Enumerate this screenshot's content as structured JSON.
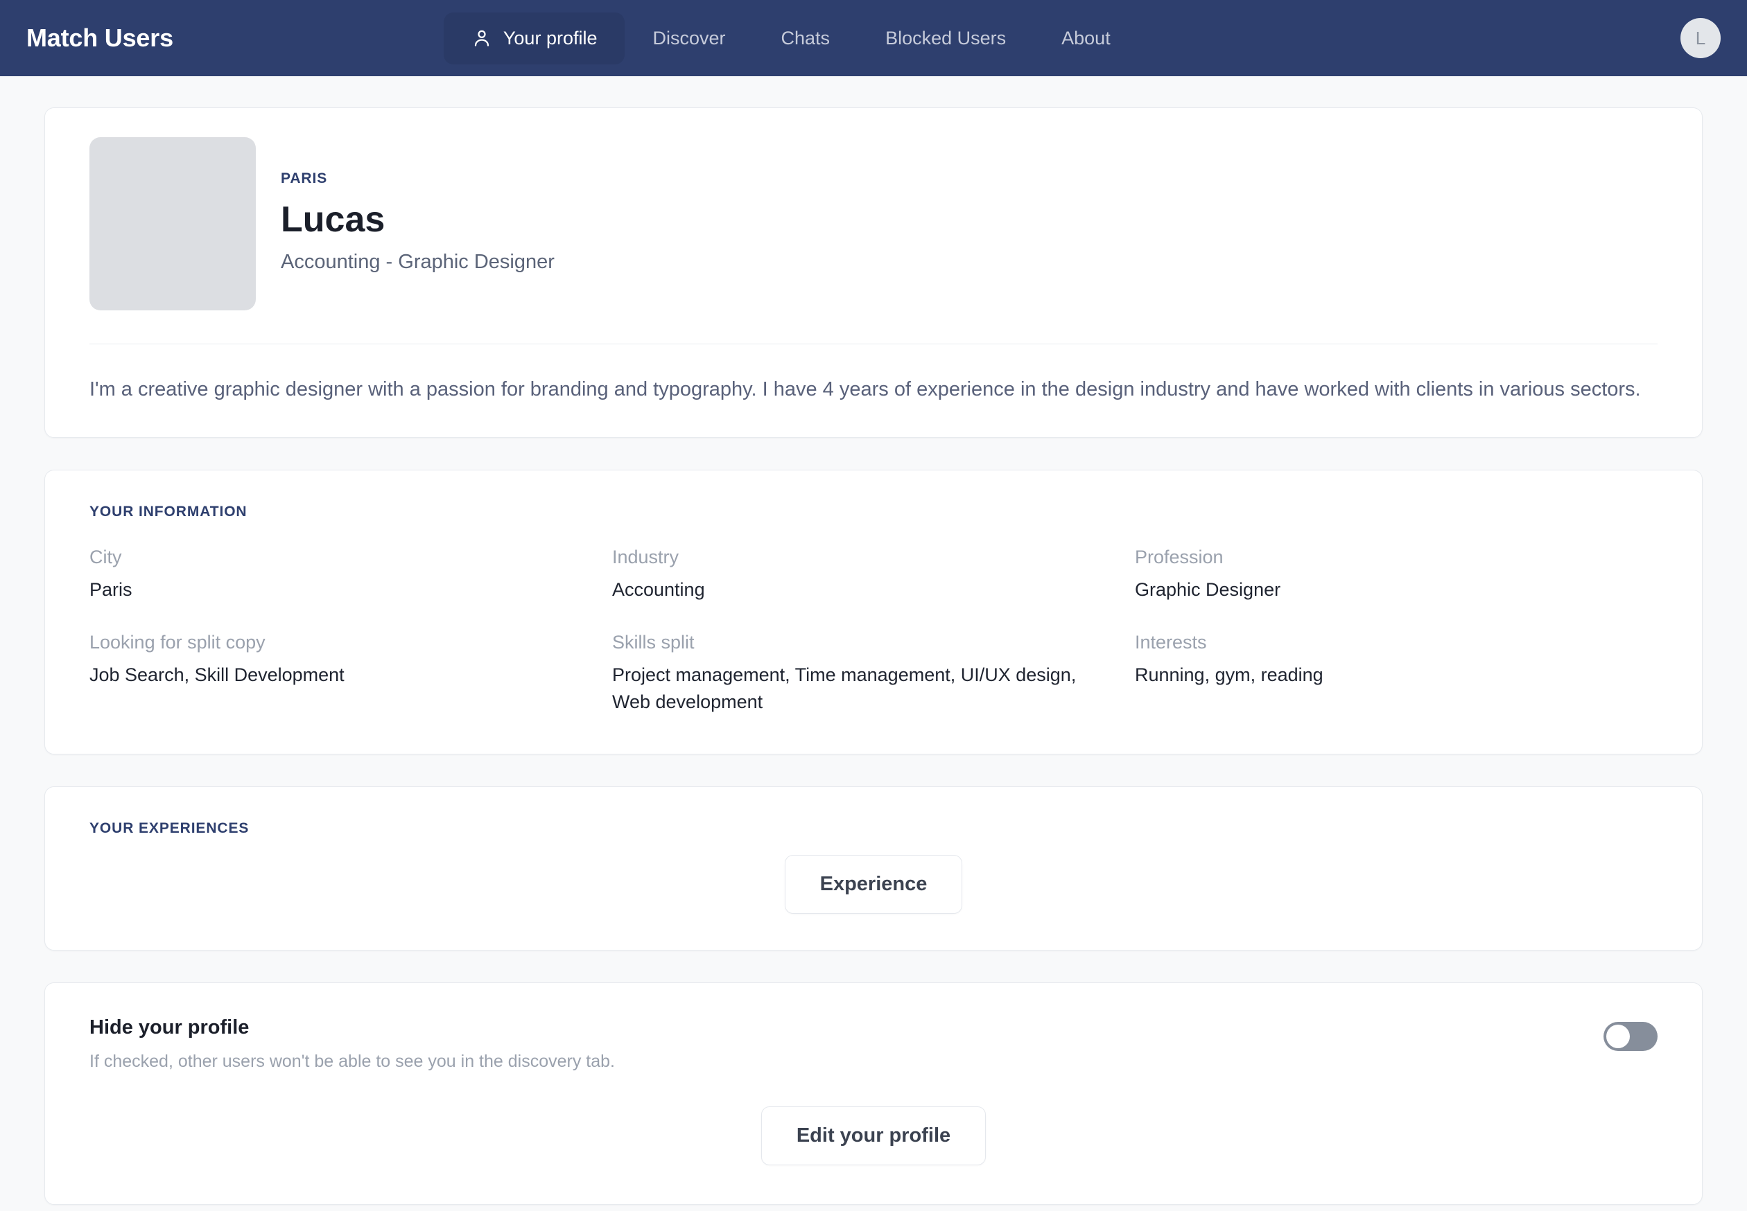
{
  "navbar": {
    "brand": "Match Users",
    "items": [
      {
        "label": "Your profile",
        "icon": "person-icon",
        "active": true
      },
      {
        "label": "Discover",
        "active": false
      },
      {
        "label": "Chats",
        "active": false
      },
      {
        "label": "Blocked Users",
        "active": false
      },
      {
        "label": "About",
        "active": false
      }
    ],
    "avatar_initial": "L",
    "bg_color": "#2e3f6e",
    "active_pill_color": "#2a3a66"
  },
  "profile": {
    "eyebrow": "PARIS",
    "name": "Lucas",
    "subtitle": "Accounting - Graphic Designer",
    "bio": "I'm a creative graphic designer with a passion for branding and typography. I have 4 years of experience in the design industry and have worked with clients in various sectors."
  },
  "information": {
    "title": "YOUR INFORMATION",
    "fields": [
      {
        "label": "City",
        "value": "Paris"
      },
      {
        "label": "Industry",
        "value": "Accounting"
      },
      {
        "label": "Profession",
        "value": "Graphic Designer"
      },
      {
        "label": "Looking for split copy",
        "value": "Job Search, Skill Development"
      },
      {
        "label": "Skills split",
        "value": "Project management, Time management, UI/UX design, Web development"
      },
      {
        "label": "Interests",
        "value": "Running, gym, reading"
      }
    ]
  },
  "experiences": {
    "title": "YOUR EXPERIENCES",
    "button_label": "Experience"
  },
  "hide_profile": {
    "title": "Hide your profile",
    "description": "If checked, other users won't be able to see you in the discovery tab.",
    "toggle_state": "off",
    "edit_button_label": "Edit your profile"
  },
  "theme": {
    "accent": "#2e3f6e",
    "page_bg": "#f8f9fa",
    "card_bg": "#ffffff",
    "card_border": "#e7eaee",
    "muted_text": "#9aa1ad"
  }
}
